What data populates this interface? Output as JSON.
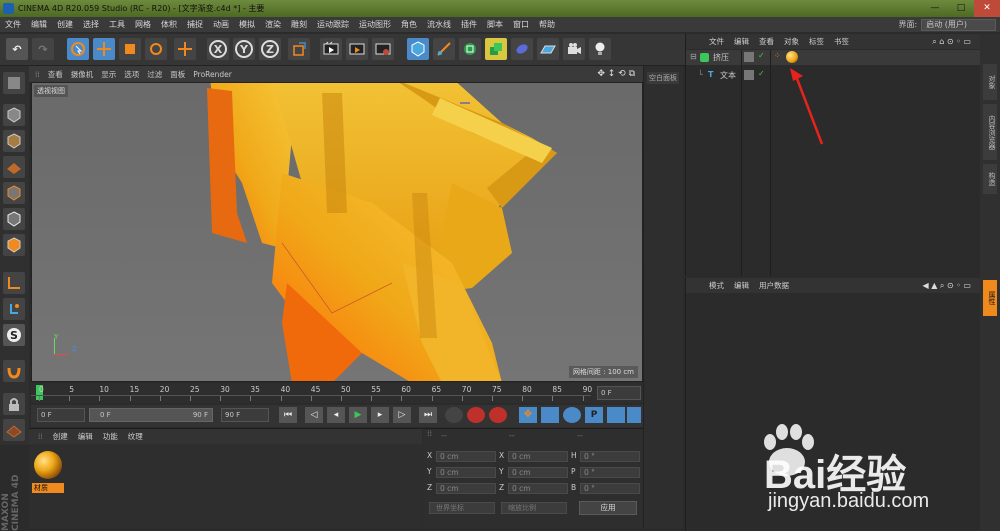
{
  "window": {
    "title": "CINEMA 4D R20.059 Studio (RC - R20) - [文字渐变.c4d *] - 主要",
    "minimize": "—",
    "maximize": "□",
    "close": "✕"
  },
  "menu": {
    "items": [
      "文件",
      "编辑",
      "创建",
      "选择",
      "工具",
      "网格",
      "体积",
      "捕捉",
      "动画",
      "模拟",
      "渲染",
      "雕刻",
      "运动跟踪",
      "运动图形",
      "角色",
      "流水线",
      "插件",
      "脚本",
      "窗口",
      "帮助"
    ]
  },
  "layout": {
    "label": "界面:",
    "value": "启动 (用户)"
  },
  "toolbar": {
    "x_axis": "X",
    "y_axis": "Y",
    "z_axis": "Z"
  },
  "viewport": {
    "menu": [
      "查看",
      "摄像机",
      "显示",
      "选项",
      "过滤",
      "面板",
      "ProRender"
    ],
    "camera_label": "透视视图",
    "grid_info": "网格间距 : 100 cm",
    "axis_y": "Y",
    "axis_z": "Z",
    "axis_x": "X"
  },
  "timeline": {
    "ticks": [
      "0",
      "5",
      "10",
      "15",
      "20",
      "25",
      "30",
      "35",
      "40",
      "45",
      "50",
      "55",
      "60",
      "65",
      "70",
      "75",
      "80",
      "85",
      "90"
    ],
    "frame_field": "0 F"
  },
  "transport": {
    "start": "0 F",
    "current": "0 F",
    "end_marker": "90 F",
    "end": "90 F"
  },
  "materials": {
    "menu": [
      "创建",
      "编辑",
      "功能",
      "纹理"
    ],
    "material_name": "材质"
  },
  "coords": {
    "headers": [
      "--",
      "--",
      "--"
    ],
    "rows": [
      {
        "a": "X",
        "av": "0 cm",
        "b": "X",
        "bv": "0 cm",
        "c": "H",
        "cv": "0 °"
      },
      {
        "a": "Y",
        "av": "0 cm",
        "b": "Y",
        "bv": "0 cm",
        "c": "P",
        "cv": "0 °"
      },
      {
        "a": "Z",
        "av": "0 cm",
        "b": "Z",
        "bv": "0 cm",
        "c": "B",
        "cv": "0 °"
      }
    ],
    "mode1": "世界坐标",
    "mode2": "缩放比例",
    "apply": "应用"
  },
  "midstrip": {
    "label": "空白面板"
  },
  "objects": {
    "menu": [
      "文件",
      "编辑",
      "查看",
      "对象",
      "标签",
      "书签"
    ],
    "items": [
      {
        "name": "挤压",
        "icon": "extrude-icon"
      },
      {
        "name": "文本",
        "icon": "text-spline-icon"
      }
    ]
  },
  "attributes": {
    "menu": [
      "模式",
      "编辑",
      "用户数据"
    ]
  },
  "right_tabs": [
    "对象",
    "内容浏览器",
    "构造"
  ],
  "right_tab_attr": "属性",
  "brand": {
    "side_logo": "MAXON CINEMA 4D"
  },
  "watermark": {
    "logo_text": "Bai经验",
    "url": "jingyan.baidu.com"
  },
  "colors": {
    "accent_orange": "#f08a1e",
    "selected_blue": "#4a8ac8",
    "titlebar_green": "#5c7a2e"
  }
}
